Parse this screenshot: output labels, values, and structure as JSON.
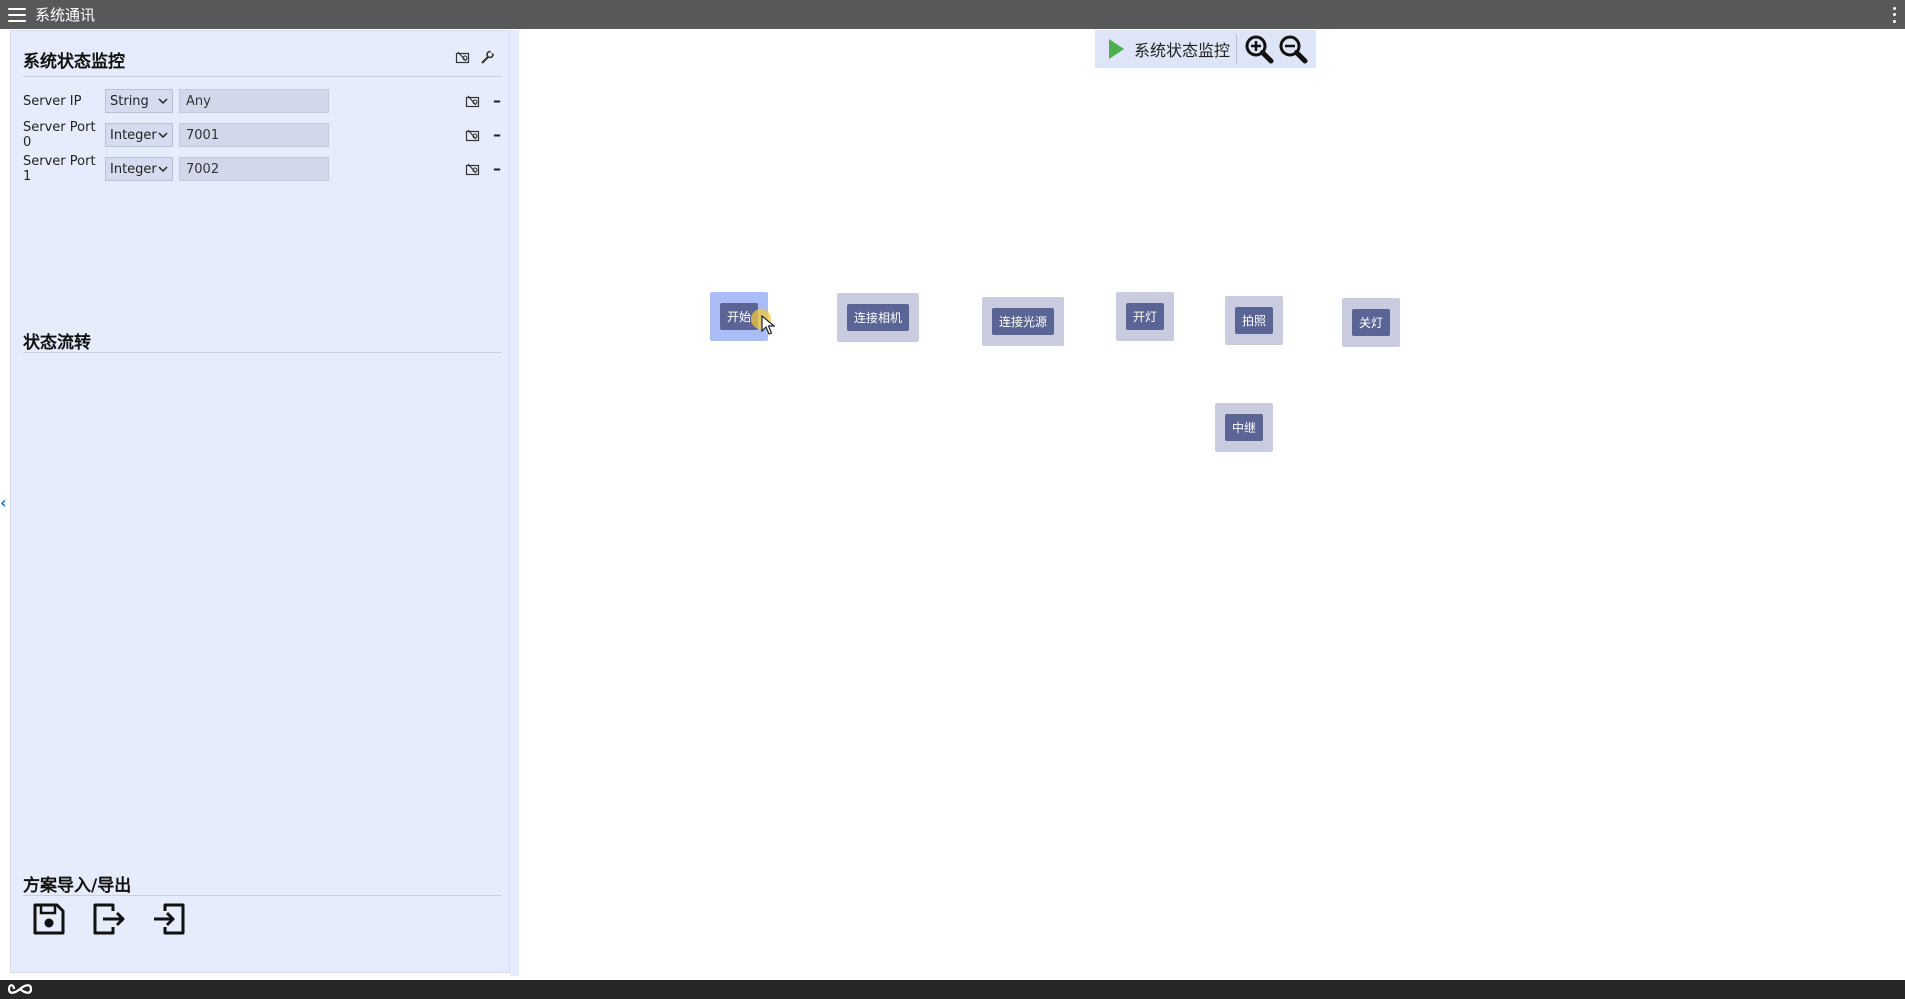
{
  "window": {
    "title": "系统通讯"
  },
  "sidebar": {
    "monitor": {
      "title": "系统状态监控",
      "params": [
        {
          "label": "Server IP",
          "type": "String",
          "value": "Any"
        },
        {
          "label": "Server Port 0",
          "type": "Integer",
          "value": "7001"
        },
        {
          "label": "Server Port 1",
          "type": "Integer",
          "value": "7002"
        }
      ]
    },
    "flow": {
      "title": "状态流转"
    },
    "scheme": {
      "title": "方案导入/导出"
    }
  },
  "toolbar": {
    "label": "系统状态监控"
  },
  "nodes": [
    {
      "label": "开始",
      "active": true
    },
    {
      "label": "连接相机"
    },
    {
      "label": "连接光源"
    },
    {
      "label": "开灯"
    },
    {
      "label": "拍照"
    },
    {
      "label": "关灯"
    },
    {
      "label": "中继"
    }
  ],
  "colors": {
    "titlebar": "#595959",
    "sidebar": "#e6ecfb",
    "node_bg": "#c9ccdf",
    "node_active": "#aabdf6",
    "node_label": "#5a6595",
    "run": "#4caf50"
  }
}
